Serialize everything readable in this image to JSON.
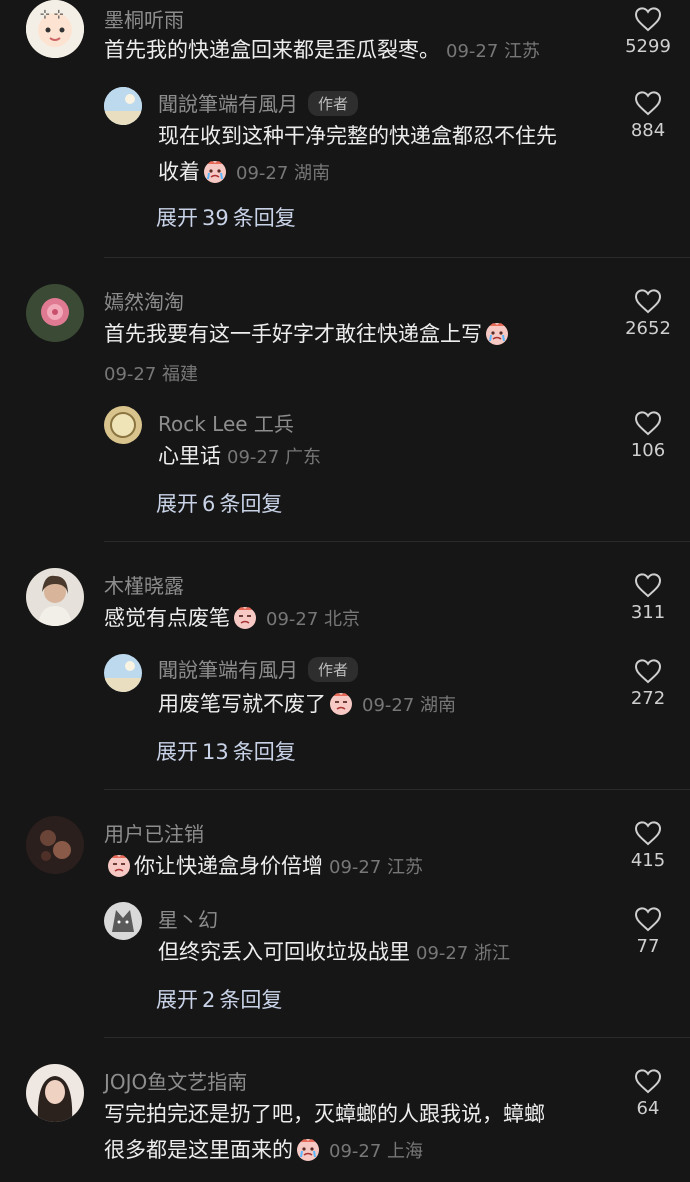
{
  "threads": [
    {
      "top": {
        "username": "墨桐听雨",
        "text": "首先我的快递盒回来都是歪瓜裂枣。",
        "meta": "09-27 江苏",
        "likes": "5299"
      },
      "reply": {
        "username": "聞說筆端有風月",
        "author_tag": "作者",
        "text_line1": "现在收到这种干净完整的快递盒都忍不住先",
        "text_line2": "收着",
        "meta": "09-27 湖南",
        "likes": "884"
      },
      "expand": {
        "a": "展开",
        "n": "39",
        "b": "条回复"
      }
    },
    {
      "top": {
        "username": "嫣然淘淘",
        "text": "首先我要有这一手好字才敢往快递盒上写",
        "meta": "09-27 福建",
        "likes": "2652"
      },
      "reply": {
        "username": "Rock Lee 工兵",
        "text": "心里话",
        "meta": "09-27 广东",
        "likes": "106"
      },
      "expand": {
        "a": "展开",
        "n": "6",
        "b": "条回复"
      }
    },
    {
      "top": {
        "username": "木槿晓露",
        "text": "感觉有点废笔",
        "meta": "09-27 北京",
        "likes": "311"
      },
      "reply": {
        "username": "聞說筆端有風月",
        "author_tag": "作者",
        "text": "用废笔写就不废了",
        "meta": "09-27 湖南",
        "likes": "272"
      },
      "expand": {
        "a": "展开",
        "n": "13",
        "b": "条回复"
      }
    },
    {
      "top": {
        "username": "用户已注销",
        "text": "你让快递盒身价倍增",
        "meta": "09-27 江苏",
        "likes": "415"
      },
      "reply": {
        "username": "星丶幻",
        "text": "但终究丢入可回收垃圾战里",
        "meta": "09-27 浙江",
        "likes": "77"
      },
      "expand": {
        "a": "展开",
        "n": "2",
        "b": "条回复"
      }
    },
    {
      "top": {
        "username": "JOJO鱼文艺指南",
        "text_line1": "写完拍完还是扔了吧，灭蟑螂的人跟我说，蟑螂",
        "text_line2": "很多都是这里面来的",
        "meta": "09-27 上海",
        "likes": "64"
      }
    }
  ],
  "colors": {
    "background": "#161616",
    "username": "#8d8d8d",
    "text": "#ededed",
    "meta": "#777777",
    "expand": "#c9d3e8"
  }
}
